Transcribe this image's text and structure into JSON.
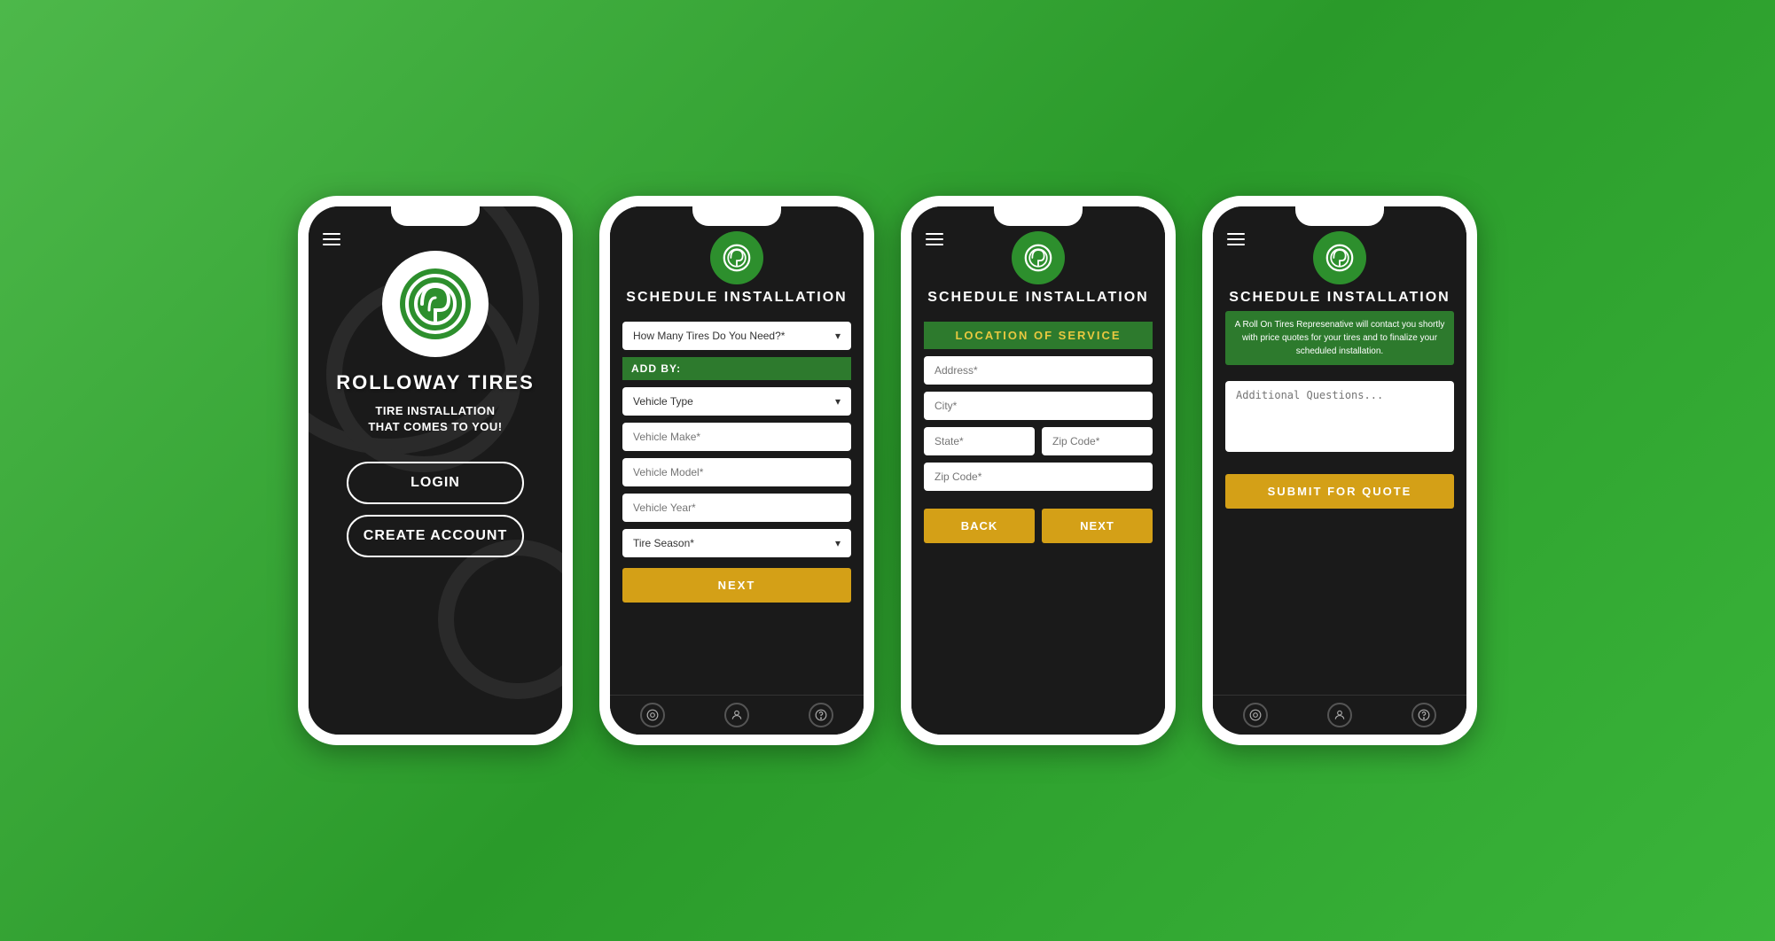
{
  "bg_color": "#3ab83a",
  "phones": [
    {
      "id": "phone1",
      "screen": "login",
      "brand": "ROLLOWAY TIRES",
      "tagline": "TIRE INSTALLATION\nTHAT COMES TO YOU!",
      "login_label": "LOGIN",
      "create_account_label": "CREATE ACCOUNT"
    },
    {
      "id": "phone2",
      "screen": "schedule1",
      "title": "SCHEDULE INSTALLATION",
      "tires_dropdown": "How Many Tires Do You Need?*",
      "add_by_label": "ADD BY:",
      "vehicle_type_label": "Vehicle Type",
      "vehicle_make_label": "Vehicle Make*",
      "vehicle_model_label": "Vehicle Model*",
      "vehicle_year_label": "Vehicle Year*",
      "tire_season_label": "Tire Season*",
      "next_label": "NEXT",
      "nav_icons": [
        "tire-icon",
        "user-icon",
        "help-icon"
      ]
    },
    {
      "id": "phone3",
      "screen": "schedule2",
      "title": "SCHEDULE INSTALLATION",
      "location_header": "LOCATION OF SERVICE",
      "address_placeholder": "Address*",
      "city_placeholder": "City*",
      "state_placeholder": "State*",
      "zip_placeholder1": "Zip Code*",
      "zip_placeholder2": "Zip Code*",
      "back_label": "BACK",
      "next_label": "NEXT"
    },
    {
      "id": "phone4",
      "screen": "schedule3",
      "title": "SCHEDULE INSTALLATION",
      "info_text": "A Roll On Tires Represenative will contact you shortly with price quotes for your tires and to finalize your scheduled installation.",
      "additional_placeholder": "Additional Questions...",
      "submit_label": "SUBMIT FOR QUOTE",
      "nav_icons": [
        "tire-icon",
        "user-icon",
        "help-icon"
      ]
    }
  ]
}
